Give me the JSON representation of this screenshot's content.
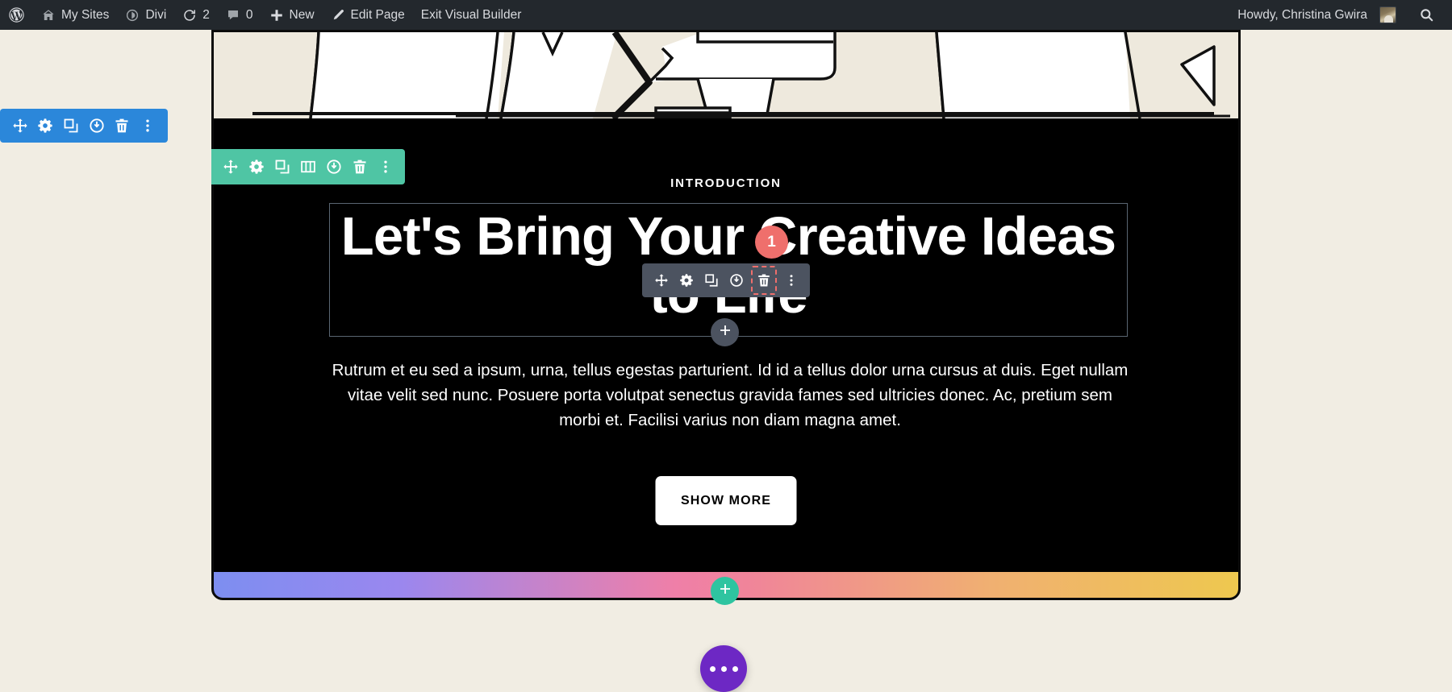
{
  "admin_bar": {
    "items": [
      {
        "icon": "wordpress-logo-icon",
        "label": ""
      },
      {
        "icon": "sites-icon",
        "label": "My Sites"
      },
      {
        "icon": "divi-icon",
        "label": "Divi"
      },
      {
        "icon": "updates-icon",
        "label": "2"
      },
      {
        "icon": "comments-icon",
        "label": "0"
      },
      {
        "icon": "plus-icon",
        "label": "New"
      },
      {
        "icon": "pencil-icon",
        "label": "Edit Page"
      },
      {
        "icon": "",
        "label": "Exit Visual Builder"
      }
    ],
    "howdy": "Howdy, Christina Gwira",
    "search_icon": "search-icon"
  },
  "section_toolbar": {
    "name": "section-settings-toolbar",
    "color": "#2b87da",
    "buttons": [
      {
        "icon": "move-icon",
        "label": "Move Section"
      },
      {
        "icon": "gear-icon",
        "label": "Section Settings"
      },
      {
        "icon": "duplicate-icon",
        "label": "Duplicate Section"
      },
      {
        "icon": "power-icon",
        "label": "Disable Section"
      },
      {
        "icon": "trash-icon",
        "label": "Delete Section"
      },
      {
        "icon": "kebab-icon",
        "label": "More Options"
      }
    ]
  },
  "row_toolbar": {
    "name": "row-settings-toolbar",
    "color": "#4fc5a4",
    "buttons": [
      {
        "icon": "move-icon",
        "label": "Move Row"
      },
      {
        "icon": "gear-icon",
        "label": "Row Settings"
      },
      {
        "icon": "duplicate-icon",
        "label": "Duplicate Row"
      },
      {
        "icon": "columns-icon",
        "label": "Change Column Structure"
      },
      {
        "icon": "power-icon",
        "label": "Disable Row"
      },
      {
        "icon": "trash-icon",
        "label": "Delete Row"
      },
      {
        "icon": "kebab-icon",
        "label": "More Options"
      }
    ]
  },
  "module_toolbar": {
    "name": "module-settings-toolbar",
    "color": "#4c5360",
    "highlight_color": "#ef6f6c",
    "badge": "1",
    "buttons": [
      {
        "icon": "move-icon",
        "label": "Move Module"
      },
      {
        "icon": "gear-icon",
        "label": "Module Settings"
      },
      {
        "icon": "duplicate-icon",
        "label": "Duplicate Module"
      },
      {
        "icon": "power-icon",
        "label": "Disable Module"
      },
      {
        "icon": "trash-icon",
        "label": "Delete Module",
        "highlighted": true
      },
      {
        "icon": "kebab-icon",
        "label": "More Options"
      }
    ]
  },
  "add_buttons": {
    "add_module": {
      "icon": "plus-icon",
      "label": "Add New Module",
      "color": "#4c5360"
    },
    "add_row": {
      "icon": "plus-icon",
      "label": "Add New Row",
      "color": "#2ec4a0"
    }
  },
  "builder_settings": {
    "icon": "ellipsis-icon",
    "label": "Builder Settings",
    "color": "#6d28c4"
  },
  "page": {
    "eyebrow": "INTRODUCTION",
    "heading": "Let's Bring Your Creative Ideas to Life",
    "body": "Rutrum et eu sed a ipsum, urna, tellus egestas parturient. Id id a tellus dolor urna cursus at duis. Eget nullam vitae velit sed nunc. Posuere porta volutpat senectus gravida fames sed ultricies donec. Ac, pretium sem morbi et. Facilisi varius non diam magna amet.",
    "cta_label": "SHOW MORE",
    "background_color": "#000000",
    "text_color": "#ffffff",
    "gradient_colors": [
      "#7d8ef0",
      "#ef7fa8",
      "#eec84f"
    ]
  }
}
